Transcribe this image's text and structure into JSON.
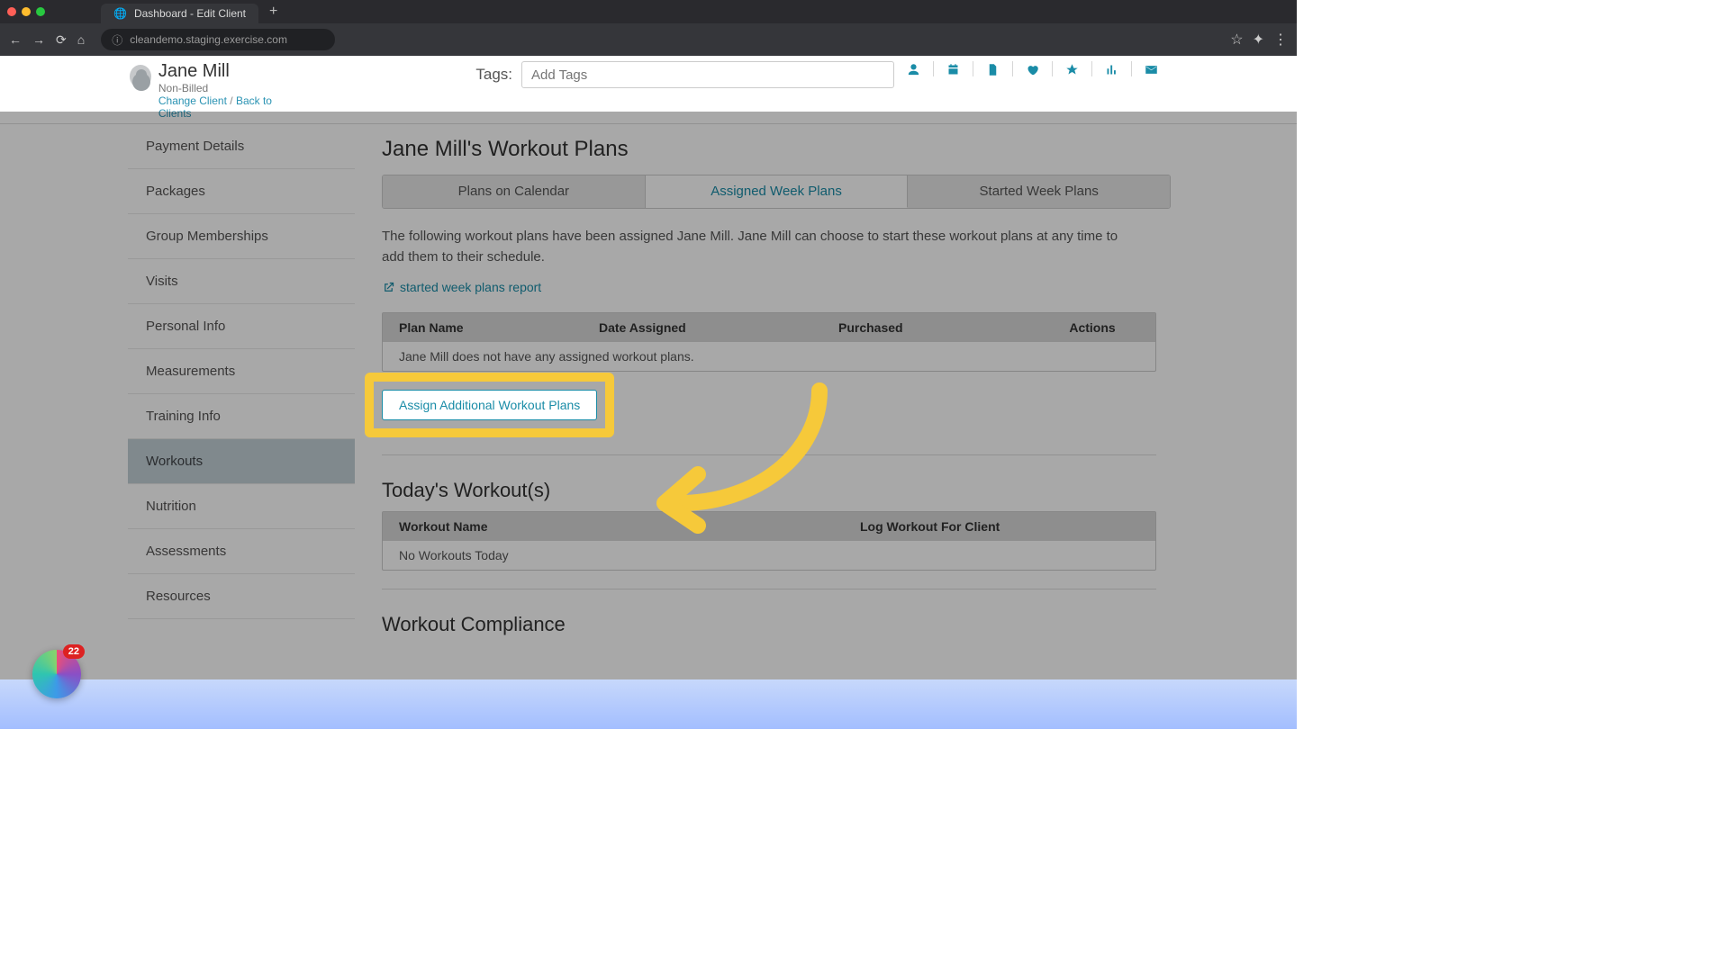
{
  "browser": {
    "tab_title": "Dashboard - Edit Client",
    "url": "cleandemo.staging.exercise.com",
    "traffic_colors": [
      "#ff5f57",
      "#febc2e",
      "#28c840"
    ]
  },
  "client": {
    "name": "Jane Mill",
    "billing": "Non-Billed",
    "change_link": "Change Client",
    "back_link": "Back to Clients"
  },
  "tags": {
    "label": "Tags:",
    "placeholder": "Add Tags"
  },
  "header_icons": [
    "user-icon",
    "calendar-icon",
    "file-icon",
    "heart-icon",
    "star-icon",
    "chart-icon",
    "mail-icon"
  ],
  "sidebar": {
    "items": [
      "Payment Details",
      "Packages",
      "Group Memberships",
      "Visits",
      "Personal Info",
      "Measurements",
      "Training Info",
      "Workouts",
      "Nutrition",
      "Assessments",
      "Resources"
    ],
    "active_index": 7
  },
  "main": {
    "title": "Jane Mill's Workout Plans",
    "tabs": [
      "Plans on Calendar",
      "Assigned Week Plans",
      "Started Week Plans"
    ],
    "active_tab": 1,
    "description": "The following workout plans have been assigned Jane Mill. Jane Mill can choose to start these workout plans at any time to add them to their schedule.",
    "report_link": "started week plans report",
    "plan_table": {
      "headers": [
        "Plan Name",
        "Date Assigned",
        "Purchased",
        "Actions"
      ],
      "empty_text": "Jane Mill does not have any assigned workout plans."
    },
    "assign_button": "Assign Additional Workout Plans",
    "today_heading": "Today's Workout(s)",
    "today_table": {
      "headers": [
        "Workout Name",
        "Log Workout For Client"
      ],
      "empty_text": "No Workouts Today"
    },
    "compliance_heading": "Workout Compliance"
  },
  "badge": {
    "count": "22"
  },
  "colors": {
    "accent": "#1a8ca7",
    "highlight": "#f6c93a"
  }
}
